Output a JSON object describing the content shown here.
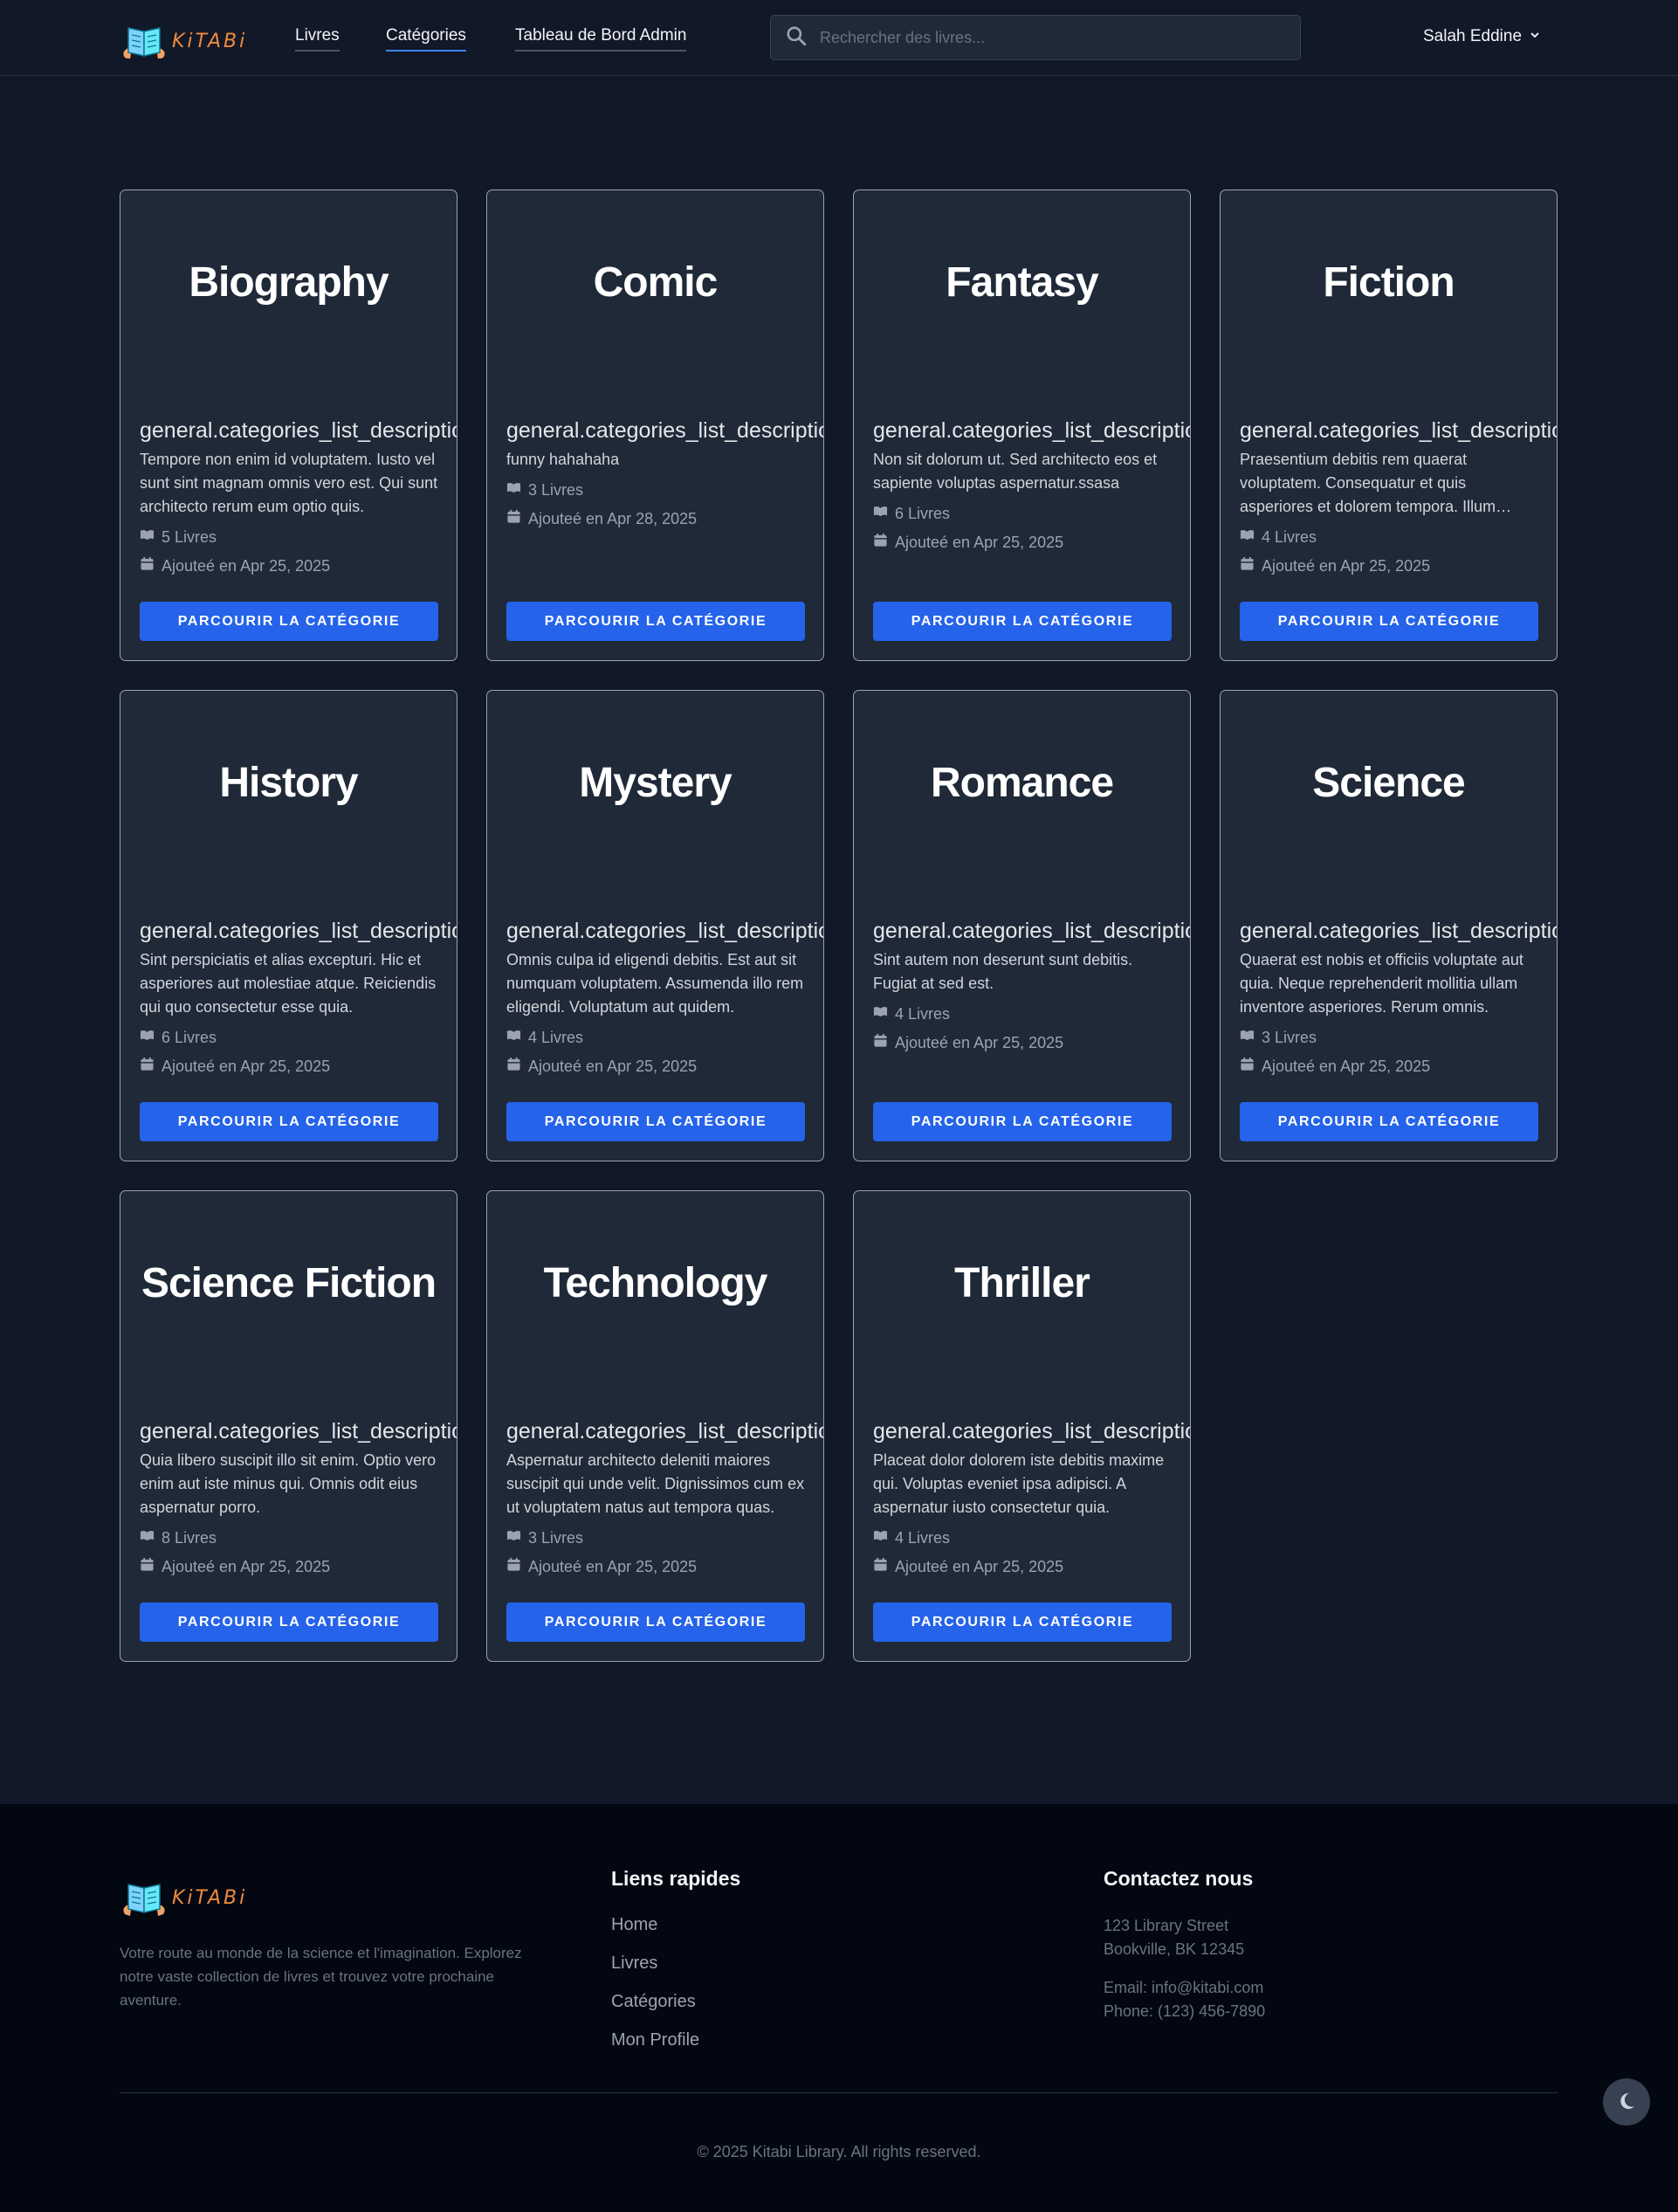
{
  "brand": {
    "name": "KiTABi"
  },
  "nav": {
    "links": [
      {
        "label": "Livres",
        "active": false
      },
      {
        "label": "Catégories",
        "active": true
      },
      {
        "label": "Tableau de Bord Admin",
        "active": false
      }
    ],
    "search_placeholder": "Rechercher des livres...",
    "user_name": "Salah Eddine"
  },
  "categories": [
    {
      "name": "Biography",
      "desc_key": "general.categories_list_description",
      "description": "Tempore non enim id voluptatem. Iusto vel sunt sint magnam omnis vero est. Qui sunt architecto rerum eum optio quis.",
      "books": "5 Livres",
      "added": "Ajouteé en Apr 25, 2025",
      "button": "PARCOURIR LA CATÉGORIE"
    },
    {
      "name": "Comic",
      "desc_key": "general.categories_list_description",
      "description": "funny hahahaha",
      "books": "3 Livres",
      "added": "Ajouteé en Apr 28, 2025",
      "button": "PARCOURIR LA CATÉGORIE"
    },
    {
      "name": "Fantasy",
      "desc_key": "general.categories_list_description",
      "description": "Non sit dolorum ut. Sed architecto eos et sapiente voluptas aspernatur.ssasa",
      "books": "6 Livres",
      "added": "Ajouteé en Apr 25, 2025",
      "button": "PARCOURIR LA CATÉGORIE"
    },
    {
      "name": "Fiction",
      "desc_key": "general.categories_list_description",
      "description": "Praesentium debitis rem quaerat voluptatem. Consequatur et quis asperiores et dolorem tempora. Illum dolores aut.",
      "books": "4 Livres",
      "added": "Ajouteé en Apr 25, 2025",
      "button": "PARCOURIR LA CATÉGORIE"
    },
    {
      "name": "History",
      "desc_key": "general.categories_list_description",
      "description": "Sint perspiciatis et alias excepturi. Hic et asperiores aut molestiae atque. Reiciendis qui quo consectetur esse quia.",
      "books": "6 Livres",
      "added": "Ajouteé en Apr 25, 2025",
      "button": "PARCOURIR LA CATÉGORIE"
    },
    {
      "name": "Mystery",
      "desc_key": "general.categories_list_description",
      "description": "Omnis culpa id eligendi debitis. Est aut sit numquam voluptatem. Assumenda illo rem eligendi. Voluptatum aut quidem.",
      "books": "4 Livres",
      "added": "Ajouteé en Apr 25, 2025",
      "button": "PARCOURIR LA CATÉGORIE"
    },
    {
      "name": "Romance",
      "desc_key": "general.categories_list_description",
      "description": "Sint autem non deserunt sunt debitis. Fugiat at sed est.",
      "books": "4 Livres",
      "added": "Ajouteé en Apr 25, 2025",
      "button": "PARCOURIR LA CATÉGORIE"
    },
    {
      "name": "Science",
      "desc_key": "general.categories_list_description",
      "description": "Quaerat est nobis et officiis voluptate aut quia. Neque reprehenderit mollitia ullam inventore asperiores. Rerum omnis.",
      "books": "3 Livres",
      "added": "Ajouteé en Apr 25, 2025",
      "button": "PARCOURIR LA CATÉGORIE"
    },
    {
      "name": "Science Fiction",
      "desc_key": "general.categories_list_description",
      "description": "Quia libero suscipit illo sit enim. Optio vero enim aut iste minus qui. Omnis odit eius aspernatur porro.",
      "books": "8 Livres",
      "added": "Ajouteé en Apr 25, 2025",
      "button": "PARCOURIR LA CATÉGORIE"
    },
    {
      "name": "Technology",
      "desc_key": "general.categories_list_description",
      "description": "Aspernatur architecto deleniti maiores suscipit qui unde velit. Dignissimos cum ex ut voluptatem natus aut tempora quas.",
      "books": "3 Livres",
      "added": "Ajouteé en Apr 25, 2025",
      "button": "PARCOURIR LA CATÉGORIE"
    },
    {
      "name": "Thriller",
      "desc_key": "general.categories_list_description",
      "description": "Placeat dolor dolorem iste debitis maxime qui. Voluptas eveniet ipsa adipisci. A aspernatur iusto consectetur quia.",
      "books": "4 Livres",
      "added": "Ajouteé en Apr 25, 2025",
      "button": "PARCOURIR LA CATÉGORIE"
    }
  ],
  "footer": {
    "about": "Votre route au monde de la science et l'imagination. Explorez notre vaste collection de livres et trouvez votre prochaine aventure.",
    "quick_links_title": "Liens rapides",
    "quick_links": [
      "Home",
      "Livres",
      "Catégories",
      "Mon Profile"
    ],
    "contact_title": "Contactez nous",
    "address_line1": "123 Library Street",
    "address_line2": "Bookville, BK 12345",
    "email": "Email: info@kitabi.com",
    "phone": "Phone: (123) 456-7890",
    "copyright": "© 2025 Kitabi Library. All rights reserved."
  },
  "colors": {
    "accent": "#2563eb",
    "brand": "#f08a3c",
    "background": "#111827",
    "card": "#1f2937"
  },
  "icons": {
    "search": "search-icon",
    "chevron": "chevron-down-icon",
    "book": "book-icon",
    "calendar": "calendar-icon",
    "theme": "moon-icon"
  }
}
